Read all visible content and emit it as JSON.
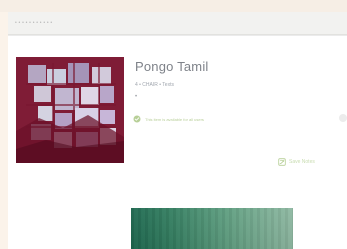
{
  "header": {
    "breadcrumb": "• • • • • • • • • • •"
  },
  "card": {
    "title": "Pongo Tamil",
    "subtitle": "4 • CHAIR • Texts",
    "badge": "•",
    "status": "This item is available for all users",
    "action": "Save Notes"
  },
  "icons": {
    "thumbnail": "grid-collage-icon",
    "status": "check-circle-icon",
    "action": "leaf-icon"
  },
  "colors": {
    "accent": "#b7cf97",
    "title": "#7e8289",
    "preview": "#2d7a5d",
    "thumb": "#7a1730"
  }
}
